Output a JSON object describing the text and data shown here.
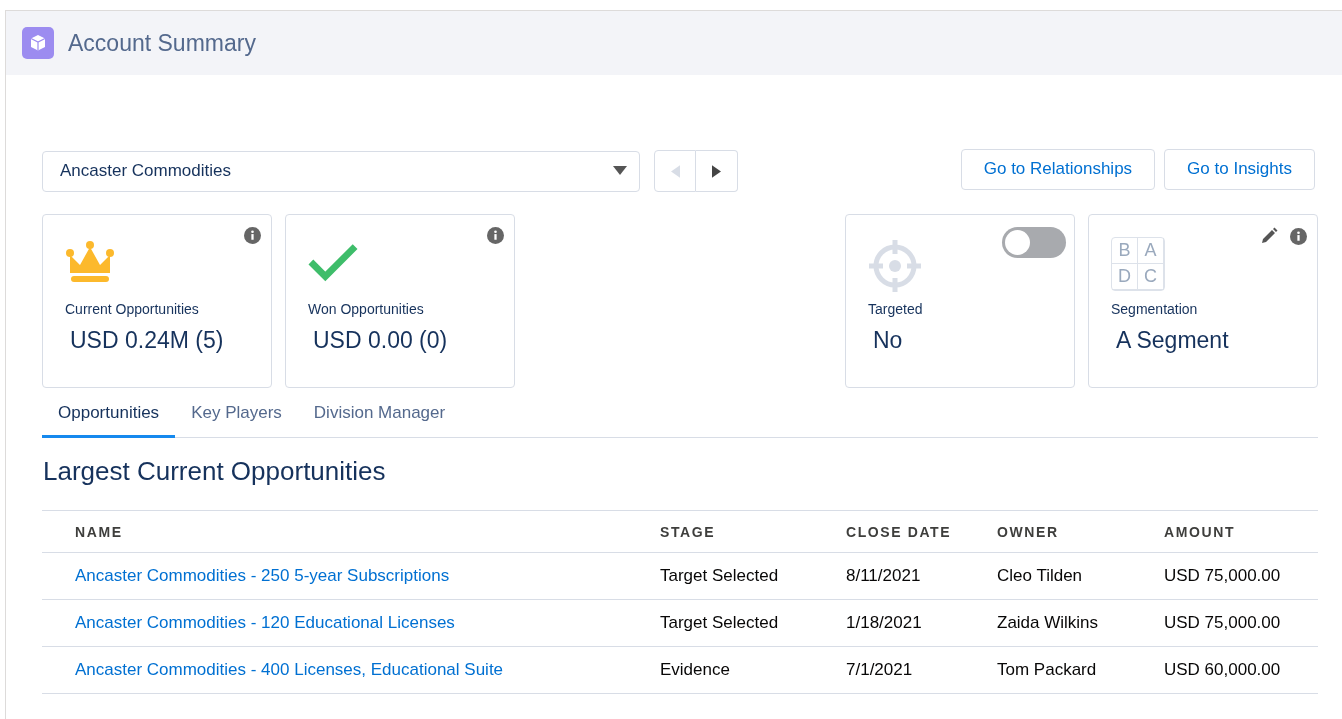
{
  "header": {
    "title": "Account Summary"
  },
  "account_select": {
    "value": "Ancaster Commodities"
  },
  "nav": {
    "prev_disabled": true,
    "next_disabled": false
  },
  "actions": [
    "Go to Relationships",
    "Go to Insights"
  ],
  "cards_left": [
    {
      "kind": "crown",
      "label": "Current Opportunities",
      "value": "USD 0.24M (5)",
      "info": true,
      "editable": false
    },
    {
      "kind": "check",
      "label": "Won Opportunities",
      "value": "USD 0.00 (0)",
      "info": true,
      "editable": false
    }
  ],
  "cards_right": [
    {
      "kind": "target",
      "label": "Targeted",
      "value": "No",
      "info": false,
      "editable": false,
      "toggle": {
        "on": false
      }
    },
    {
      "kind": "segment",
      "label": "Segmentation",
      "value": "A Segment",
      "info": true,
      "editable": true,
      "grid_letters": [
        "B",
        "A",
        "D",
        "C"
      ]
    }
  ],
  "tabs": [
    {
      "label": "Opportunities",
      "selected": true
    },
    {
      "label": "Key Players",
      "selected": false
    },
    {
      "label": "Division Manager",
      "selected": false
    }
  ],
  "section_title": "Largest Current Opportunities",
  "table": {
    "columns": [
      "NAME",
      "STAGE",
      "CLOSE DATE",
      "OWNER",
      "AMOUNT"
    ],
    "rows": [
      [
        "Ancaster Commodities - 250 5-year Subscriptions",
        "Target Selected",
        "8/11/2021",
        "Cleo Tilden",
        "USD 75,000.00"
      ],
      [
        "Ancaster Commodities - 120 Educational Licenses",
        "Target Selected",
        "1/18/2021",
        "Zaida Wilkins",
        "USD 75,000.00"
      ],
      [
        "Ancaster Commodities - 400 Licenses, Educational Suite",
        "Evidence",
        "7/1/2021",
        "Tom Packard",
        "USD 60,000.00"
      ]
    ]
  }
}
